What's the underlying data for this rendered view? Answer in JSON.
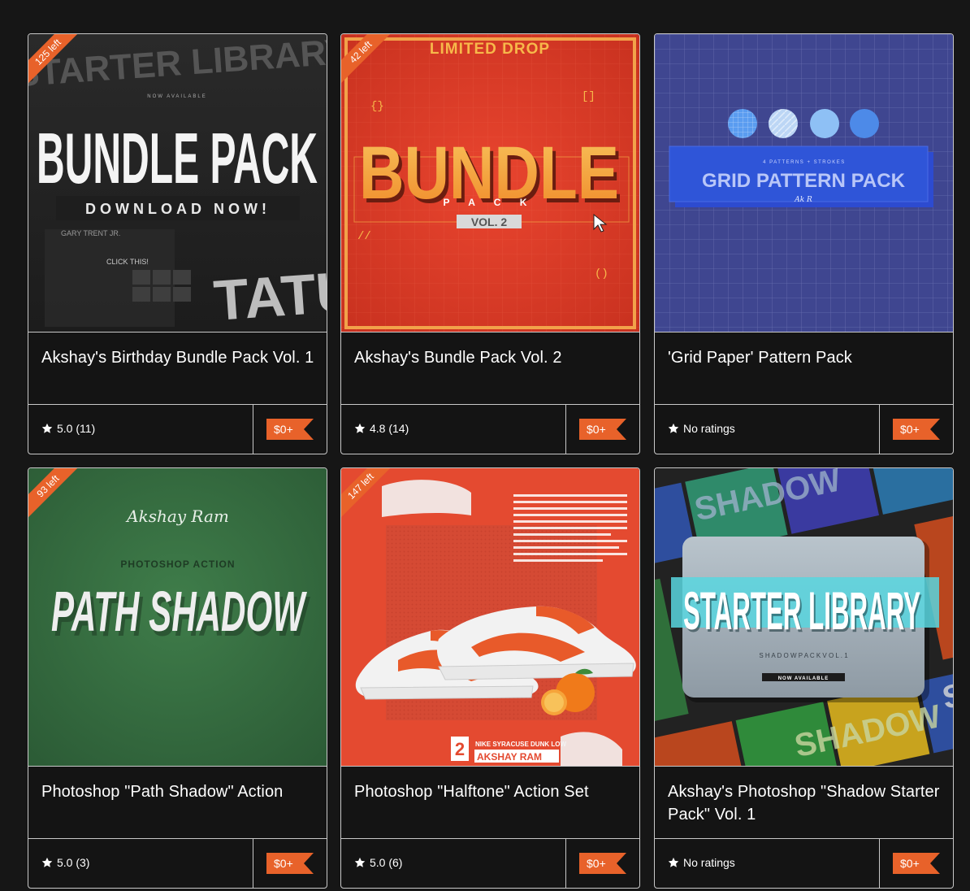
{
  "products": [
    {
      "title": "Akshay's Birthday Bundle Pack Vol. 1",
      "rating": "5.0 (11)",
      "price": "$0+",
      "ribbon": "125 left",
      "thumb": {
        "top": "STARTER LIBRARY",
        "sub": "NOW AVAILABLE",
        "main": "BUNDLE PACK",
        "bar": "DOWNLOAD NOW!",
        "side": "GARY TRENT JR.",
        "click": "CLICK THIS!",
        "big": "TATU"
      }
    },
    {
      "title": "Akshay's Bundle Pack Vol. 2",
      "rating": "4.8 (14)",
      "price": "$0+",
      "ribbon": "42 left",
      "thumb": {
        "top": "LIMITED DROP",
        "main": "BUNDLE",
        "pack": "P A C K",
        "vol": "VOL. 2"
      }
    },
    {
      "title": "'Grid Paper' Pattern Pack",
      "rating": "No ratings",
      "price": "$0+",
      "ribbon": "",
      "thumb": {
        "small": "4 PATTERNS + STROKES",
        "main": "GRID PATTERN PACK",
        "sig": "Ak R"
      }
    },
    {
      "title": "Photoshop \"Path Shadow\" Action",
      "rating": "5.0 (3)",
      "price": "$0+",
      "ribbon": "93 left",
      "thumb": {
        "sig": "Akshay Ram",
        "sub": "PHOTOSHOP ACTION",
        "main": "PATH SHADOW"
      }
    },
    {
      "title": "Photoshop \"Halftone\" Action Set",
      "rating": "5.0 (6)",
      "price": "$0+",
      "ribbon": "147 left",
      "thumb": {
        "num": "2",
        "line1": "NIKE SYRACUSE DUNK LOW",
        "line2": "AKSHAY RAM"
      }
    },
    {
      "title": "Akshay's Photoshop \"Shadow Starter Pack\" Vol. 1",
      "rating": "No ratings",
      "price": "$0+",
      "ribbon": "",
      "thumb": {
        "main": "STARTER LIBRARY",
        "sub": "S H A D O W   P A C K   V O L .  1",
        "bar": "NOW AVAILABLE",
        "bg1": "SHADOW",
        "bg2": "SHA"
      }
    }
  ],
  "colors": {
    "accent": "#e8622a",
    "background": "#161616",
    "border": "#c8c8c8"
  },
  "icons": {
    "rating": "star-icon",
    "price": "price-tag-icon"
  }
}
